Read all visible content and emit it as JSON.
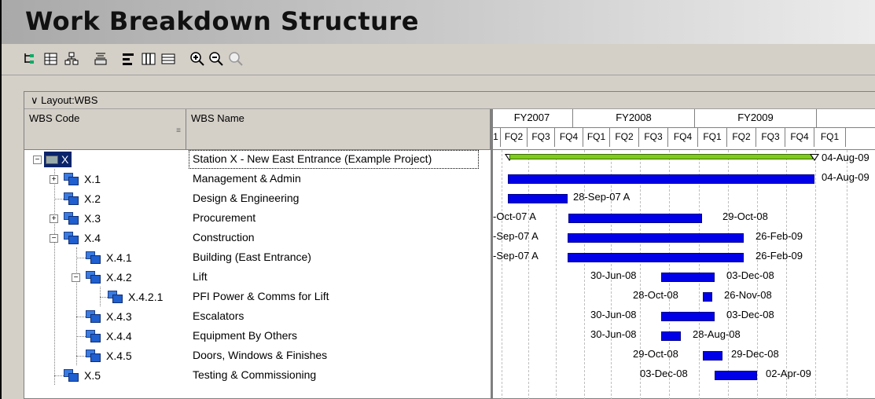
{
  "app": {
    "title": "Work Breakdown Structure"
  },
  "toolbar": {
    "icons": [
      "wbs-tree-icon",
      "expand-grid-icon",
      "org-chart-icon",
      "chart-levels-icon",
      "bars-icon",
      "columns-icon",
      "table-view-icon",
      "zoom-in-icon",
      "zoom-out-icon",
      "zoom-fit-icon"
    ]
  },
  "layout": {
    "label": "Layout:WBS"
  },
  "columns": {
    "code": "WBS Code",
    "name": "WBS Name"
  },
  "timescale": {
    "years": [
      "FY2007",
      "FY2008",
      "FY2009"
    ],
    "quarters": [
      "1",
      "FQ2",
      "FQ3",
      "FQ4",
      "FQ1",
      "FQ2",
      "FQ3",
      "FQ4",
      "FQ1",
      "FQ2",
      "FQ3",
      "FQ4",
      "FQ1"
    ]
  },
  "rows": [
    {
      "code": "X",
      "name": "Station X - New East Entrance (Example Project)",
      "start_label": "",
      "finish_label": "04-Aug-09"
    },
    {
      "code": "X.1",
      "name": "Management & Admin",
      "start_label": "",
      "finish_label": "04-Aug-09"
    },
    {
      "code": "X.2",
      "name": "Design & Engineering",
      "start_label": "",
      "finish_label": "28-Sep-07 A"
    },
    {
      "code": "X.3",
      "name": "Procurement",
      "start_label": "-Oct-07 A",
      "finish_label": "29-Oct-08"
    },
    {
      "code": "X.4",
      "name": "Construction",
      "start_label": "-Sep-07 A",
      "finish_label": "26-Feb-09"
    },
    {
      "code": "X.4.1",
      "name": "Building (East Entrance)",
      "start_label": "-Sep-07 A",
      "finish_label": "26-Feb-09"
    },
    {
      "code": "X.4.2",
      "name": "Lift",
      "start_label": "30-Jun-08",
      "finish_label": "03-Dec-08"
    },
    {
      "code": "X.4.2.1",
      "name": "PFI Power & Comms for Lift",
      "start_label": "28-Oct-08",
      "finish_label": "26-Nov-08"
    },
    {
      "code": "X.4.3",
      "name": "Escalators",
      "start_label": "30-Jun-08",
      "finish_label": "03-Dec-08"
    },
    {
      "code": "X.4.4",
      "name": "Equipment By Others",
      "start_label": "30-Jun-08",
      "finish_label": "28-Aug-08"
    },
    {
      "code": "X.4.5",
      "name": "Doors, Windows & Finishes",
      "start_label": "29-Oct-08",
      "finish_label": "29-Dec-08"
    },
    {
      "code": "X.5",
      "name": "Testing & Commissioning",
      "start_label": "03-Dec-08",
      "finish_label": "02-Apr-09"
    }
  ],
  "colors": {
    "bar": "#0000e8",
    "project_bar": "#7fcc1a",
    "selection": "#0a246a"
  }
}
